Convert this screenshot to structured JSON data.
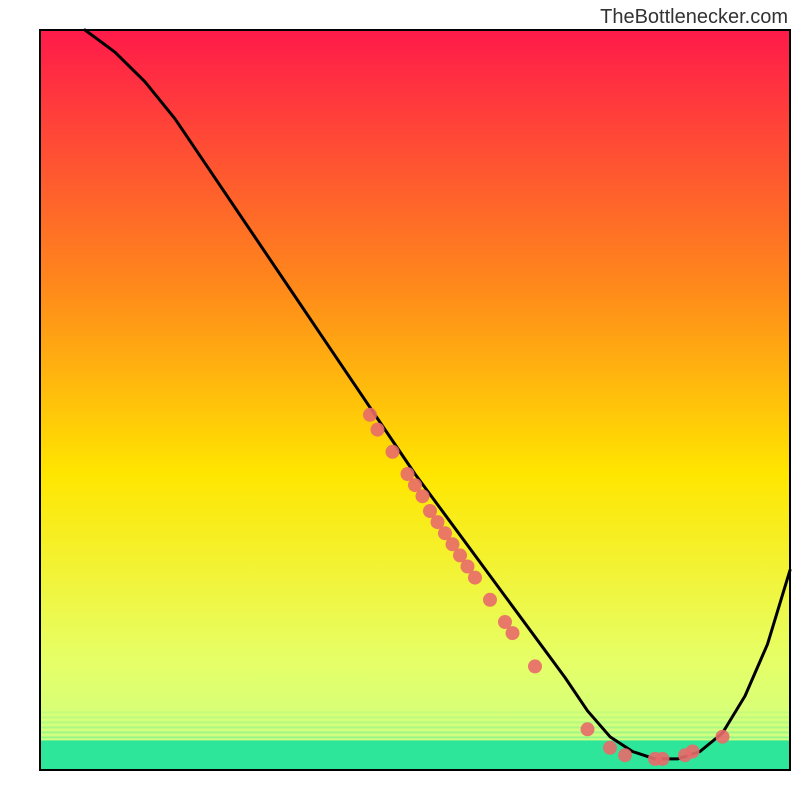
{
  "watermark": "TheBottlenecker.com",
  "chart_data": {
    "type": "line",
    "title": "",
    "xlabel": "",
    "ylabel": "",
    "xlim": [
      0,
      100
    ],
    "ylim": [
      0,
      100
    ],
    "grid": false,
    "legend": false,
    "background_gradient": {
      "top": "#ff1a4a",
      "mid_upper": "#ff8a1a",
      "mid": "#ffe600",
      "lower": "#e6ff66",
      "bottom_band": "#2ee69a"
    },
    "green_band_y_range": [
      0,
      4
    ],
    "series": [
      {
        "name": "curve",
        "color": "#000000",
        "x": [
          6,
          8,
          10,
          14,
          18,
          22,
          26,
          30,
          34,
          38,
          42,
          46,
          50,
          54,
          58,
          62,
          66,
          70,
          73,
          76,
          79,
          82,
          85,
          88,
          91,
          94,
          97,
          100
        ],
        "y": [
          100,
          98.5,
          97,
          93,
          88,
          82,
          76,
          70,
          64,
          58,
          52,
          46,
          40,
          34.5,
          29,
          23.5,
          18,
          12.5,
          8,
          4.5,
          2.5,
          1.5,
          1.5,
          2.5,
          5,
          10,
          17,
          27
        ]
      }
    ],
    "scatter": {
      "color": "#e86a6a",
      "radius": 7,
      "points": [
        {
          "x": 44,
          "y": 48
        },
        {
          "x": 45,
          "y": 46
        },
        {
          "x": 47,
          "y": 43
        },
        {
          "x": 49,
          "y": 40
        },
        {
          "x": 50,
          "y": 38.5
        },
        {
          "x": 51,
          "y": 37
        },
        {
          "x": 52,
          "y": 35
        },
        {
          "x": 53,
          "y": 33.5
        },
        {
          "x": 54,
          "y": 32
        },
        {
          "x": 55,
          "y": 30.5
        },
        {
          "x": 56,
          "y": 29
        },
        {
          "x": 57,
          "y": 27.5
        },
        {
          "x": 58,
          "y": 26
        },
        {
          "x": 60,
          "y": 23
        },
        {
          "x": 62,
          "y": 20
        },
        {
          "x": 63,
          "y": 18.5
        },
        {
          "x": 66,
          "y": 14
        },
        {
          "x": 73,
          "y": 5.5
        },
        {
          "x": 76,
          "y": 3
        },
        {
          "x": 78,
          "y": 2
        },
        {
          "x": 82,
          "y": 1.5
        },
        {
          "x": 83,
          "y": 1.5
        },
        {
          "x": 86,
          "y": 2
        },
        {
          "x": 87,
          "y": 2.5
        },
        {
          "x": 91,
          "y": 4.5
        }
      ]
    }
  }
}
